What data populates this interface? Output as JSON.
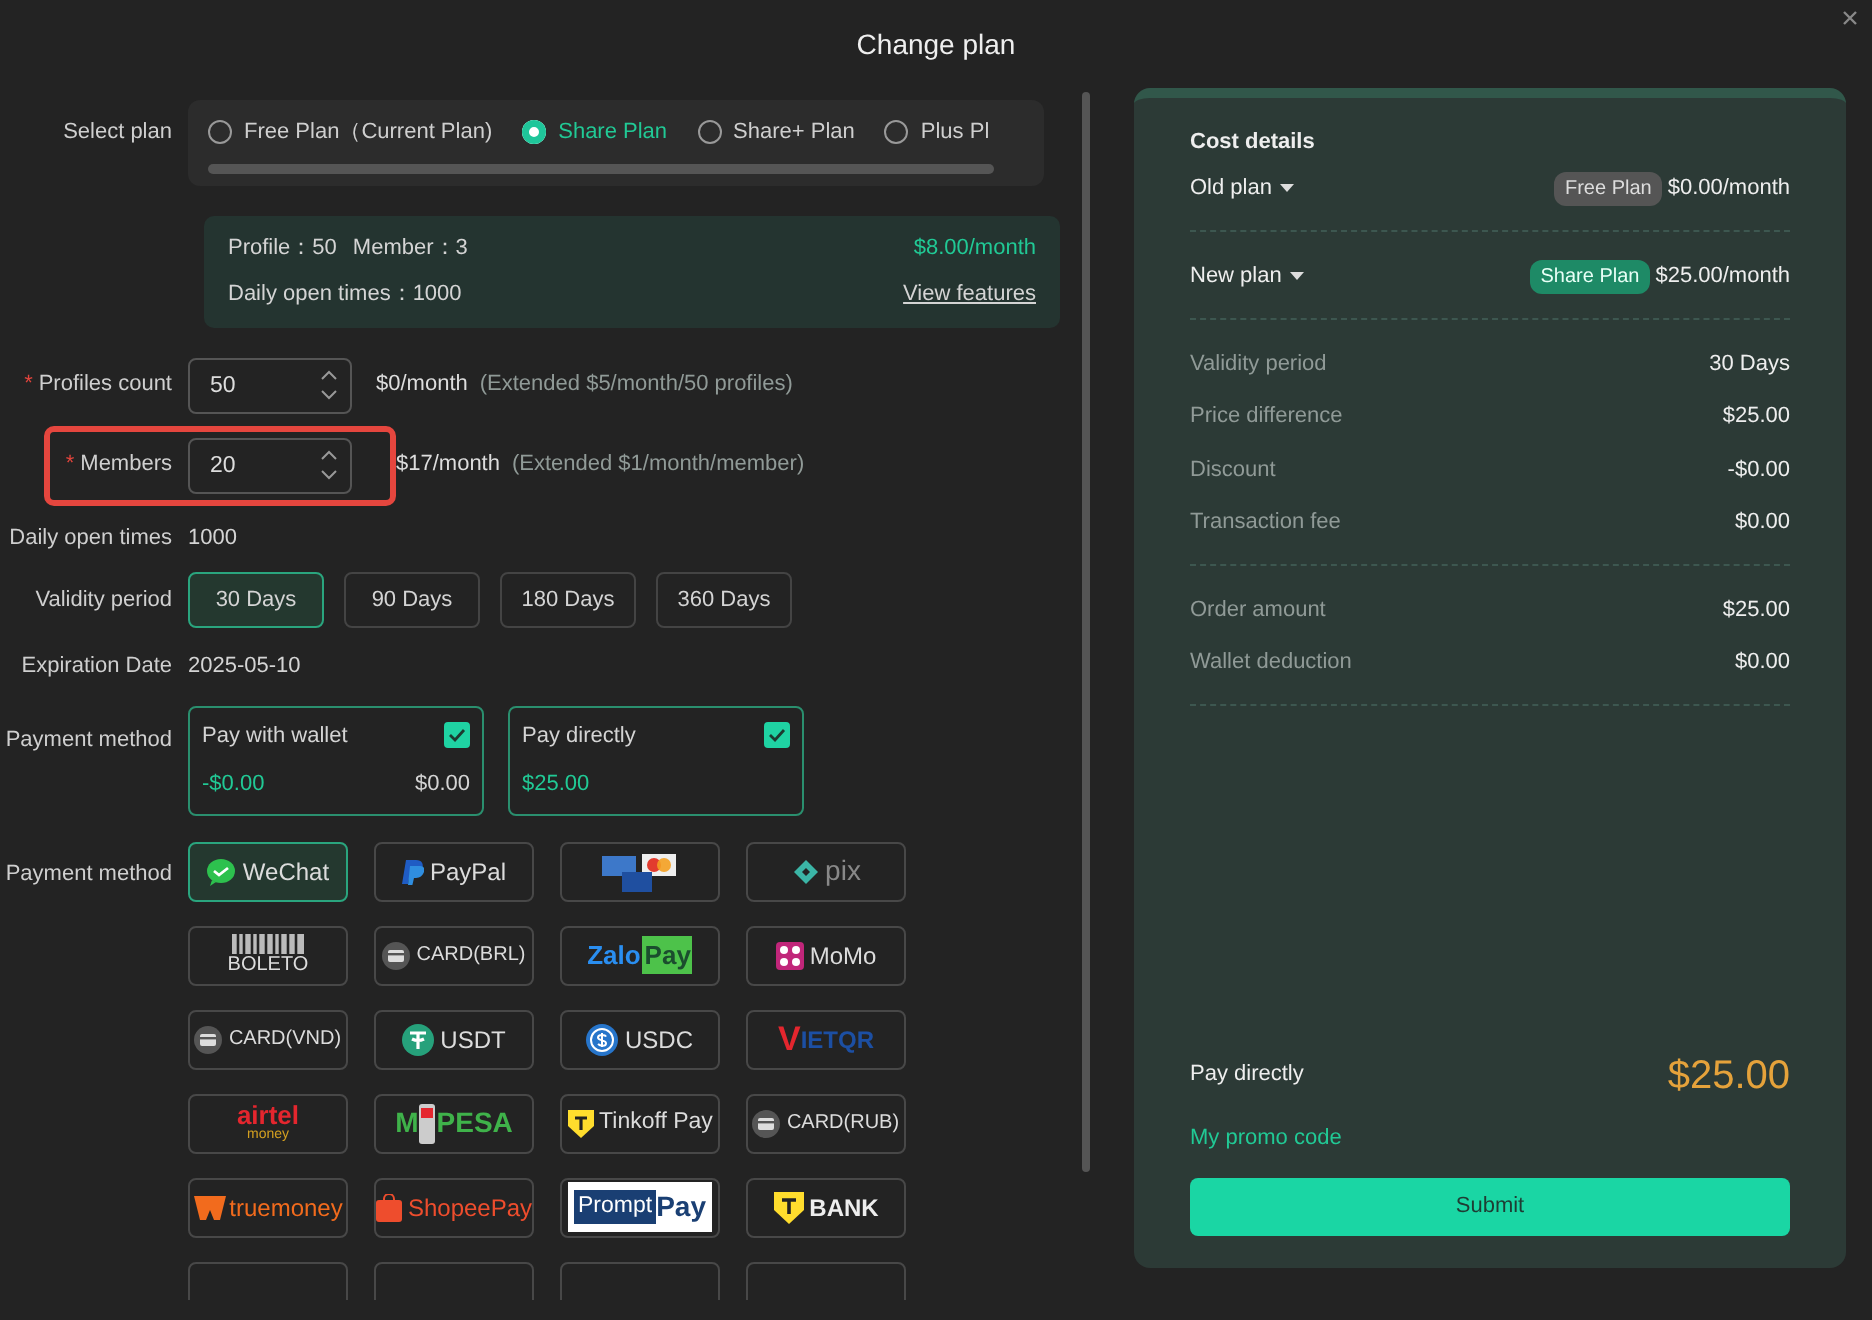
{
  "dialog": {
    "title": "Change plan"
  },
  "select_plan": {
    "label": "Select plan",
    "options": [
      {
        "label": "Free Plan（Current Plan)",
        "selected": false
      },
      {
        "label": "Share Plan",
        "selected": true
      },
      {
        "label": "Share+ Plan",
        "selected": false
      },
      {
        "label": "Plus Pl",
        "selected": false
      }
    ]
  },
  "plan_info": {
    "profile": "Profile：50",
    "member": "Member：3",
    "daily": "Daily open times：1000",
    "price": "$8.00/month",
    "link": "View features"
  },
  "profiles_count": {
    "required_mark": "*",
    "label": "Profiles count",
    "value": "50",
    "price": "$0/month",
    "note": "(Extended $5/month/50 profiles)",
    "highlighted": false
  },
  "members": {
    "required_mark": "*",
    "label": "Members",
    "value": "20",
    "price": "$17/month",
    "note": "(Extended $1/month/member)",
    "highlighted": true
  },
  "daily_open_times": {
    "label": "Daily open times",
    "value": "1000"
  },
  "validity_period": {
    "label": "Validity period",
    "options": [
      {
        "label": "30 Days",
        "selected": true
      },
      {
        "label": "90 Days",
        "selected": false
      },
      {
        "label": "180 Days",
        "selected": false
      },
      {
        "label": "360 Days",
        "selected": false
      }
    ]
  },
  "expiration_date": {
    "label": "Expiration Date",
    "value": "2025-05-10"
  },
  "payment_source": {
    "label": "Payment method",
    "options": [
      {
        "title": "Pay with wallet",
        "checked": true,
        "amount": "-$0.00",
        "balance": "$0.00"
      },
      {
        "title": "Pay directly",
        "checked": true,
        "amount": "$25.00"
      }
    ]
  },
  "payment_channels": {
    "label": "Payment method",
    "items": [
      {
        "kind": "wechat",
        "label": "WeChat",
        "selected": true
      },
      {
        "kind": "paypal",
        "label": "PayPal",
        "selected": false
      },
      {
        "kind": "cards",
        "selected": false
      },
      {
        "kind": "pix",
        "label": "pix",
        "selected": false
      },
      {
        "kind": "boleto",
        "label": "BOLETO",
        "selected": false
      },
      {
        "kind": "card",
        "label": "CARD(BRL)",
        "selected": false
      },
      {
        "kind": "zalopay",
        "label": "Zalo",
        "label2": "Pay",
        "selected": false
      },
      {
        "kind": "momo",
        "label": "MoMo",
        "selected": false
      },
      {
        "kind": "card",
        "label": "CARD(VND)",
        "selected": false
      },
      {
        "kind": "usdt",
        "label": "USDT",
        "selected": false
      },
      {
        "kind": "usdc",
        "label": "USDC",
        "selected": false
      },
      {
        "kind": "vietqr",
        "label": "V",
        "label2": "IETQR",
        "selected": false
      },
      {
        "kind": "airtel",
        "label": "airtel",
        "label2": "money",
        "selected": false
      },
      {
        "kind": "mpesa",
        "label": "M",
        "label2": "PESA",
        "selected": false
      },
      {
        "kind": "tinkoff",
        "label": "Tinkoff Pay",
        "selected": false
      },
      {
        "kind": "card",
        "label": "CARD(RUB)",
        "selected": false
      },
      {
        "kind": "truemoney",
        "label": "truemoney",
        "selected": false
      },
      {
        "kind": "shopee",
        "label": "ShopeePay",
        "selected": false
      },
      {
        "kind": "promptpay",
        "label": "Prompt",
        "label2": "Pay",
        "selected": false
      },
      {
        "kind": "tbank",
        "label": "BANK",
        "selected": false
      },
      {
        "kind": "cut",
        "selected": false
      },
      {
        "kind": "cut",
        "selected": false
      },
      {
        "kind": "cut",
        "selected": false
      },
      {
        "kind": "cut",
        "selected": false
      }
    ]
  },
  "cost_details": {
    "title": "Cost details",
    "old_plan": {
      "label": "Old plan",
      "tag": "Free Plan",
      "price": "$0.00/month"
    },
    "new_plan": {
      "label": "New plan",
      "tag": "Share Plan",
      "price": "$25.00/month"
    },
    "lines": [
      {
        "label": "Validity period",
        "value": "30 Days"
      },
      {
        "label": "Price difference",
        "value": "$25.00"
      },
      {
        "label": "Discount",
        "value": "-$0.00"
      },
      {
        "label": "Transaction fee",
        "value": "$0.00"
      }
    ],
    "totals": [
      {
        "label": "Order amount",
        "value": "$25.00"
      },
      {
        "label": "Wallet deduction",
        "value": "$0.00"
      }
    ],
    "pay": {
      "label": "Pay directly",
      "amount": "$25.00"
    },
    "promo": "My promo code",
    "submit": "Submit"
  }
}
